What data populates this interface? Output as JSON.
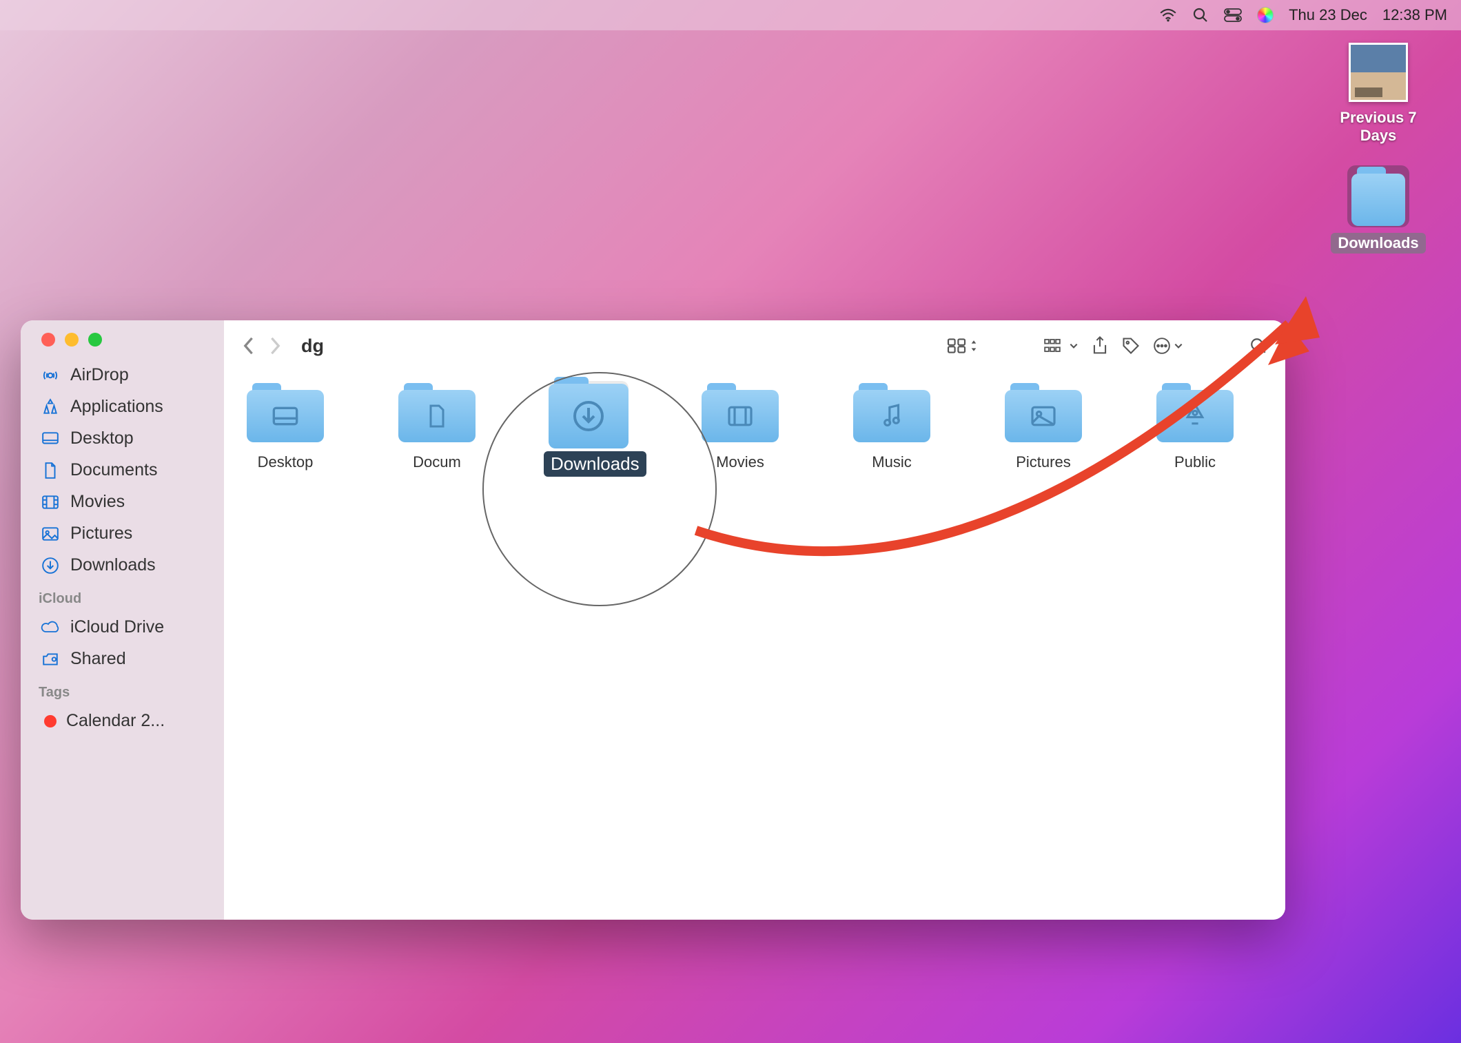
{
  "menubar": {
    "date": "Thu 23 Dec",
    "time": "12:38 PM"
  },
  "desktop": {
    "items": [
      {
        "label": "Previous 7 Days",
        "selected": false,
        "icon": "image"
      },
      {
        "label": "Downloads",
        "selected": true,
        "icon": "folder"
      }
    ]
  },
  "finder": {
    "title": "dg",
    "sidebar": {
      "favorites": [
        {
          "label": "AirDrop",
          "icon": "airdrop"
        },
        {
          "label": "Applications",
          "icon": "apps"
        },
        {
          "label": "Desktop",
          "icon": "desktop"
        },
        {
          "label": "Documents",
          "icon": "documents"
        },
        {
          "label": "Movies",
          "icon": "movies"
        },
        {
          "label": "Pictures",
          "icon": "pictures"
        },
        {
          "label": "Downloads",
          "icon": "downloads"
        }
      ],
      "icloud_header": "iCloud",
      "icloud": [
        {
          "label": "iCloud Drive",
          "icon": "cloud"
        },
        {
          "label": "Shared",
          "icon": "shared"
        }
      ],
      "tags_header": "Tags",
      "tags": [
        {
          "label": "Calendar 2...",
          "color": "#ff3b30"
        }
      ]
    },
    "items": [
      {
        "label": "Desktop",
        "icon": "desktop",
        "selected": false
      },
      {
        "label": "Docum",
        "icon": "documents",
        "selected": false
      },
      {
        "label": "Downloads",
        "icon": "downloads",
        "selected": true
      },
      {
        "label": "Movies",
        "icon": "movies",
        "selected": false
      },
      {
        "label": "Music",
        "icon": "music",
        "selected": false
      },
      {
        "label": "Pictures",
        "icon": "pictures",
        "selected": false
      },
      {
        "label": "Public",
        "icon": "public",
        "selected": false
      }
    ]
  },
  "annotation": {
    "arrow_color": "#e8432b"
  }
}
